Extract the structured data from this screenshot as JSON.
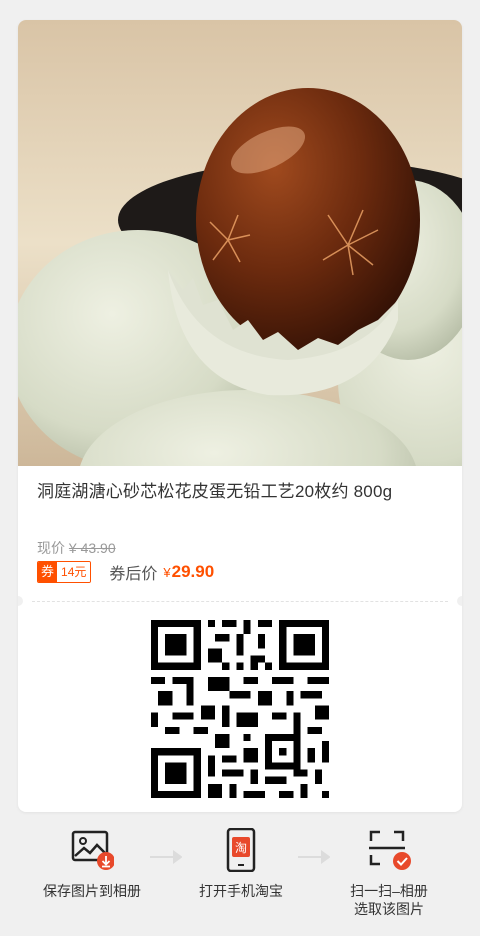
{
  "product": {
    "title": "洞庭湖溏心砂芯松花皮蛋无铅工艺20枚约 800g",
    "original_price_label": "现价",
    "original_price": "¥ 43.90",
    "coupon_tag": "券",
    "coupon_amount": "14元",
    "after_coupon_label": "券后价",
    "currency": "¥",
    "final_price": "29.90"
  },
  "actions": [
    {
      "icon": "image-download-icon",
      "label": "保存图片到相册"
    },
    {
      "icon": "taobao-phone-icon",
      "label": "打开手机淘宝",
      "badge": "淘"
    },
    {
      "icon": "scan-check-icon",
      "label_line1": "扫一扫–相册",
      "label_line2": "选取该图片"
    }
  ],
  "colors": {
    "accent": "#ff5000",
    "background": "#f0f0f0",
    "card": "#ffffff"
  }
}
